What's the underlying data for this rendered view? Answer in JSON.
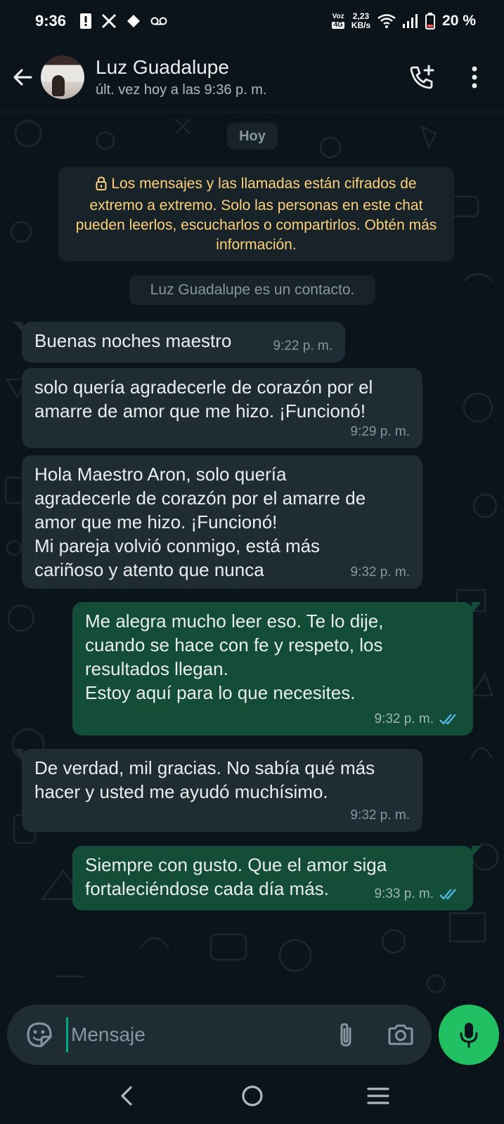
{
  "status_bar": {
    "time": "9:36",
    "network_top": "Voz",
    "network_bottom": "4G",
    "speed_top": "2,23",
    "speed_bottom": "KB/s",
    "battery": "20 %"
  },
  "header": {
    "contact_name": "Luz Guadalupe",
    "last_seen": "últ. vez hoy a las 9:36 p. m."
  },
  "chat": {
    "date_label": "Hoy",
    "encryption_notice": "Los mensajes y las llamadas están cifrados de extremo a extremo. Solo las personas en este chat pueden leerlos, escucharlos o compartirlos. Obtén más información.",
    "contact_notice": "Luz Guadalupe es un contacto.",
    "messages": [
      {
        "direction": "in",
        "text": "Buenas noches maestro",
        "time": "9:22 p. m."
      },
      {
        "direction": "in",
        "text": "solo quería agradecerle de corazón por el\namarre de amor que me hizo. ¡Funcionó!",
        "time": "9:29 p. m."
      },
      {
        "direction": "in",
        "text": "Hola Maestro Aron, solo quería\nagradecerle de corazón por el amarre de\namor que me hizo. ¡Funcionó!\nMi pareja volvió conmigo, está más\ncariñoso y atento que nunca",
        "time": "9:32 p. m."
      },
      {
        "direction": "out",
        "text": "Me alegra mucho leer eso. Te lo dije,\ncuando se hace con fe y respeto, los\nresultados llegan.\nEstoy aquí para lo que necesites.",
        "time": "9:32 p. m.",
        "status": "read"
      },
      {
        "direction": "in",
        "text": "De verdad, mil gracias. No sabía qué más\nhacer y usted me ayudó muchísimo.",
        "time": "9:32 p. m."
      },
      {
        "direction": "out",
        "text": "Siempre con gusto. Que el amor siga\nfortaleciéndose cada día más.",
        "time": "9:33 p. m.",
        "status": "read"
      }
    ]
  },
  "input": {
    "placeholder": "Mensaje"
  },
  "colors": {
    "background": "#0b141a",
    "incoming_bubble": "#202c33",
    "outgoing_bubble": "#144d37",
    "accent": "#21c063",
    "read_ticks": "#53bdeb",
    "notice_text": "#ffd279"
  },
  "icons": {
    "back": "arrow-left-icon",
    "add_call": "add-call-icon",
    "menu": "more-vertical-icon",
    "emoji": "sticker-icon",
    "attach": "paperclip-icon",
    "camera": "camera-icon",
    "mic": "microphone-icon",
    "lock": "lock-icon",
    "read": "double-check-icon"
  }
}
